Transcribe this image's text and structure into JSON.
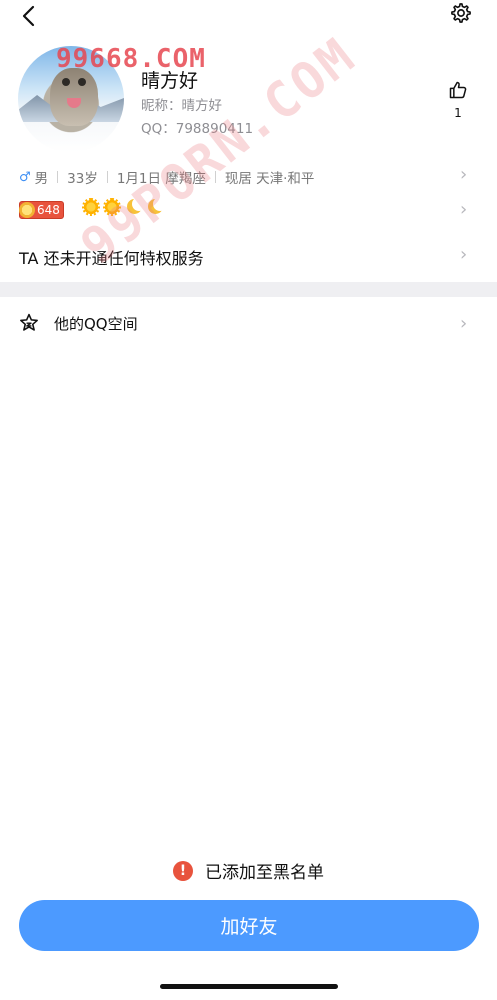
{
  "watermarks": {
    "top": "99668.COM",
    "diagonal": "99PORN.COM"
  },
  "profile": {
    "name": "晴方好",
    "nickname": "昵称：晴方好",
    "qq": "QQ：798890411",
    "like_count": "1"
  },
  "info": {
    "gender_symbol": "♂",
    "gender": "男",
    "age": "33岁",
    "birthday": "1月1日 摩羯座",
    "location": "现居 天津·和平"
  },
  "level": {
    "value": "648",
    "icons": [
      "sun-icon",
      "sun-icon",
      "moon-icon",
      "moon-icon"
    ]
  },
  "privilege_text": "TA 还未开通任何特权服务",
  "qzone_label": "他的QQ空间",
  "blacklist_notice": "已添加至黑名单",
  "add_friend_label": "加好友",
  "colors": {
    "primary": "#4c9aff",
    "warning": "#e8533d",
    "secondary_text": "#8e8e93"
  }
}
